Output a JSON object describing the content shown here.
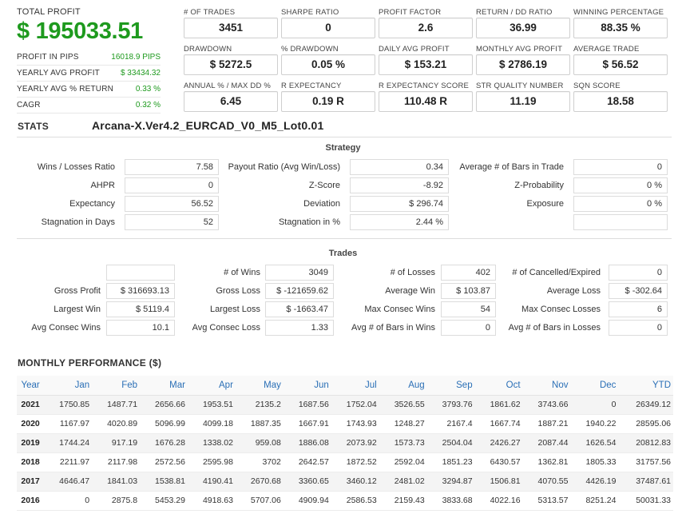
{
  "summary": {
    "total_profit_label": "TOTAL PROFIT",
    "total_profit_value": "$ 195033.51",
    "rows": [
      {
        "label": "PROFIT IN PIPS",
        "value": "16018.9 PIPS"
      },
      {
        "label": "YEARLY AVG PROFIT",
        "value": "$ 33434.32"
      },
      {
        "label": "YEARLY AVG % RETURN",
        "value": "0.33 %"
      },
      {
        "label": "CAGR",
        "value": "0.32 %"
      }
    ]
  },
  "metrics": [
    {
      "label": "# OF TRADES",
      "value": "3451"
    },
    {
      "label": "SHARPE RATIO",
      "value": "0"
    },
    {
      "label": "PROFIT FACTOR",
      "value": "2.6"
    },
    {
      "label": "RETURN / DD RATIO",
      "value": "36.99"
    },
    {
      "label": "WINNING PERCENTAGE",
      "value": "88.35 %"
    },
    {
      "label": "DRAWDOWN",
      "value": "$ 5272.5"
    },
    {
      "label": "% DRAWDOWN",
      "value": "0.05 %"
    },
    {
      "label": "DAILY AVG PROFIT",
      "value": "$ 153.21"
    },
    {
      "label": "MONTHLY AVG PROFIT",
      "value": "$ 2786.19"
    },
    {
      "label": "AVERAGE TRADE",
      "value": "$ 56.52"
    },
    {
      "label": "ANNUAL % / MAX DD %",
      "value": "6.45"
    },
    {
      "label": "R EXPECTANCY",
      "value": "0.19 R"
    },
    {
      "label": "R EXPECTANCY SCORE",
      "value": "110.48 R"
    },
    {
      "label": "STR QUALITY NUMBER",
      "value": "11.19"
    },
    {
      "label": "SQN SCORE",
      "value": "18.58"
    }
  ],
  "stats": {
    "label": "STATS",
    "strategy_name": "Arcana-X.Ver4.2_EURCAD_V0_M5_Lot0.01"
  },
  "strategy": {
    "title": "Strategy",
    "rows": [
      [
        {
          "label": "Wins / Losses Ratio",
          "value": "7.58"
        },
        {
          "label": "Payout Ratio (Avg Win/Loss)",
          "value": "0.34"
        },
        {
          "label": "Average # of Bars in Trade",
          "value": "0"
        }
      ],
      [
        {
          "label": "AHPR",
          "value": "0"
        },
        {
          "label": "Z-Score",
          "value": "-8.92"
        },
        {
          "label": "Z-Probability",
          "value": "0 %"
        }
      ],
      [
        {
          "label": "Expectancy",
          "value": "56.52"
        },
        {
          "label": "Deviation",
          "value": "$ 296.74"
        },
        {
          "label": "Exposure",
          "value": "0 %"
        }
      ],
      [
        {
          "label": "Stagnation in Days",
          "value": "52"
        },
        {
          "label": "Stagnation in %",
          "value": "2.44 %"
        },
        {
          "label": "",
          "value": ""
        }
      ]
    ]
  },
  "trades": {
    "title": "Trades",
    "rows": [
      [
        {
          "label": "",
          "value": ""
        },
        {
          "label": "# of Wins",
          "value": "3049"
        },
        {
          "label": "# of Losses",
          "value": "402"
        },
        {
          "label": "# of Cancelled/Expired",
          "value": "0"
        }
      ],
      [
        {
          "label": "Gross Profit",
          "value": "$ 316693.13"
        },
        {
          "label": "Gross Loss",
          "value": "$ -121659.62"
        },
        {
          "label": "Average Win",
          "value": "$ 103.87"
        },
        {
          "label": "Average Loss",
          "value": "$ -302.64"
        }
      ],
      [
        {
          "label": "Largest Win",
          "value": "$ 5119.4"
        },
        {
          "label": "Largest Loss",
          "value": "$ -1663.47"
        },
        {
          "label": "Max Consec Wins",
          "value": "54"
        },
        {
          "label": "Max Consec Losses",
          "value": "6"
        }
      ],
      [
        {
          "label": "Avg Consec Wins",
          "value": "10.1"
        },
        {
          "label": "Avg Consec Loss",
          "value": "1.33"
        },
        {
          "label": "Avg # of Bars in Wins",
          "value": "0"
        },
        {
          "label": "Avg # of Bars in Losses",
          "value": "0"
        }
      ]
    ]
  },
  "monthly": {
    "title": "MONTHLY PERFORMANCE ($)",
    "headers": [
      "Year",
      "Jan",
      "Feb",
      "Mar",
      "Apr",
      "May",
      "Jun",
      "Jul",
      "Aug",
      "Sep",
      "Oct",
      "Nov",
      "Dec",
      "YTD"
    ],
    "rows": [
      [
        "2021",
        "1750.85",
        "1487.71",
        "2656.66",
        "1953.51",
        "2135.2",
        "1687.56",
        "1752.04",
        "3526.55",
        "3793.76",
        "1861.62",
        "3743.66",
        "0",
        "26349.12"
      ],
      [
        "2020",
        "1167.97",
        "4020.89",
        "5096.99",
        "4099.18",
        "1887.35",
        "1667.91",
        "1743.93",
        "1248.27",
        "2167.4",
        "1667.74",
        "1887.21",
        "1940.22",
        "28595.06"
      ],
      [
        "2019",
        "1744.24",
        "917.19",
        "1676.28",
        "1338.02",
        "959.08",
        "1886.08",
        "2073.92",
        "1573.73",
        "2504.04",
        "2426.27",
        "2087.44",
        "1626.54",
        "20812.83"
      ],
      [
        "2018",
        "2211.97",
        "2117.98",
        "2572.56",
        "2595.98",
        "3702",
        "2642.57",
        "1872.52",
        "2592.04",
        "1851.23",
        "6430.57",
        "1362.81",
        "1805.33",
        "31757.56"
      ],
      [
        "2017",
        "4646.47",
        "1841.03",
        "1538.81",
        "4190.41",
        "2670.68",
        "3360.65",
        "3460.12",
        "2481.02",
        "3294.87",
        "1506.81",
        "4070.55",
        "4426.19",
        "37487.61"
      ],
      [
        "2016",
        "0",
        "2875.8",
        "5453.29",
        "4918.63",
        "5707.06",
        "4909.94",
        "2586.53",
        "2159.43",
        "3833.68",
        "4022.16",
        "5313.57",
        "8251.24",
        "50031.33"
      ]
    ]
  }
}
